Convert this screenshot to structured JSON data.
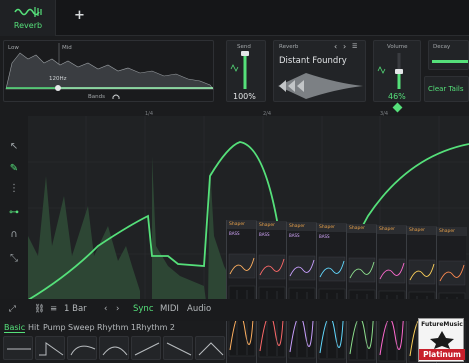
{
  "tabs": {
    "active": "Reverb",
    "add_icon": "plus-icon"
  },
  "eq": {
    "low_label": "Low",
    "mid_label": "Mid",
    "freq": "120Hz",
    "bands_label": "Bands"
  },
  "send": {
    "label": "Send",
    "value": "100%",
    "level": 1.0
  },
  "reverb": {
    "label": "Reverb",
    "preset": "Distant Foundry"
  },
  "volume": {
    "label": "Volume",
    "value": "46%",
    "level": 0.46
  },
  "decay": {
    "label": "Decay"
  },
  "clear_tails": {
    "label": "Clear Tails"
  },
  "ruler": {
    "marks": [
      "1/4",
      "2/4",
      "3/4"
    ]
  },
  "bottom": {
    "rate": "1 Bar",
    "sync": "Sync",
    "midi": "MIDI",
    "audio": "Audio"
  },
  "preset_tabs": [
    "Basic",
    "Hit",
    "Pump",
    "Sweep",
    "Rhythm 1",
    "Rhythm 2"
  ],
  "shapers": [
    {
      "title": "Shaper",
      "name": "BASS"
    },
    {
      "title": "Shaper",
      "name": "BASS"
    },
    {
      "title": "Shaper",
      "name": "BASS"
    },
    {
      "title": "Shaper",
      "name": "BASS"
    },
    {
      "title": "Shaper",
      "name": ""
    },
    {
      "title": "Shaper",
      "name": ""
    },
    {
      "title": "Shaper",
      "name": ""
    },
    {
      "title": "Shaper",
      "name": ""
    }
  ],
  "badge": {
    "line1": "FutureMusic",
    "line2": "Platinum"
  },
  "colors": {
    "accent": "#55e07a",
    "background": "#1b1c1e",
    "panel": "#222427",
    "badge_red": "#c8202c"
  }
}
